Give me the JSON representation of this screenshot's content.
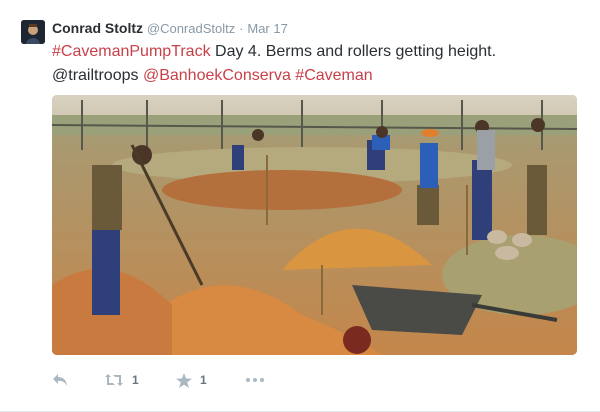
{
  "tweet": {
    "author": {
      "fullname": "Conrad Stoltz",
      "username": "@ConradStoltz",
      "separator": "·",
      "timestamp": "Mar 17"
    },
    "text": {
      "hashtag_pumptrack": "#CavemanPumpTrack",
      "line1_rest": " Day 4. Berms and rollers getting height.",
      "mention_trailtroops": "@trailtroops",
      "mention_banhoek": "@BanhoekConserva",
      "hashtag_caveman": "#Caveman"
    },
    "actions": {
      "reply_icon": "reply-icon",
      "retweet_icon": "retweet-icon",
      "retweet_count": "1",
      "like_icon": "star-icon",
      "like_count": "1",
      "more_icon": "more-icon"
    },
    "colors": {
      "link": "#c8414a",
      "muted": "#8899a6",
      "text": "#292f33"
    }
  }
}
